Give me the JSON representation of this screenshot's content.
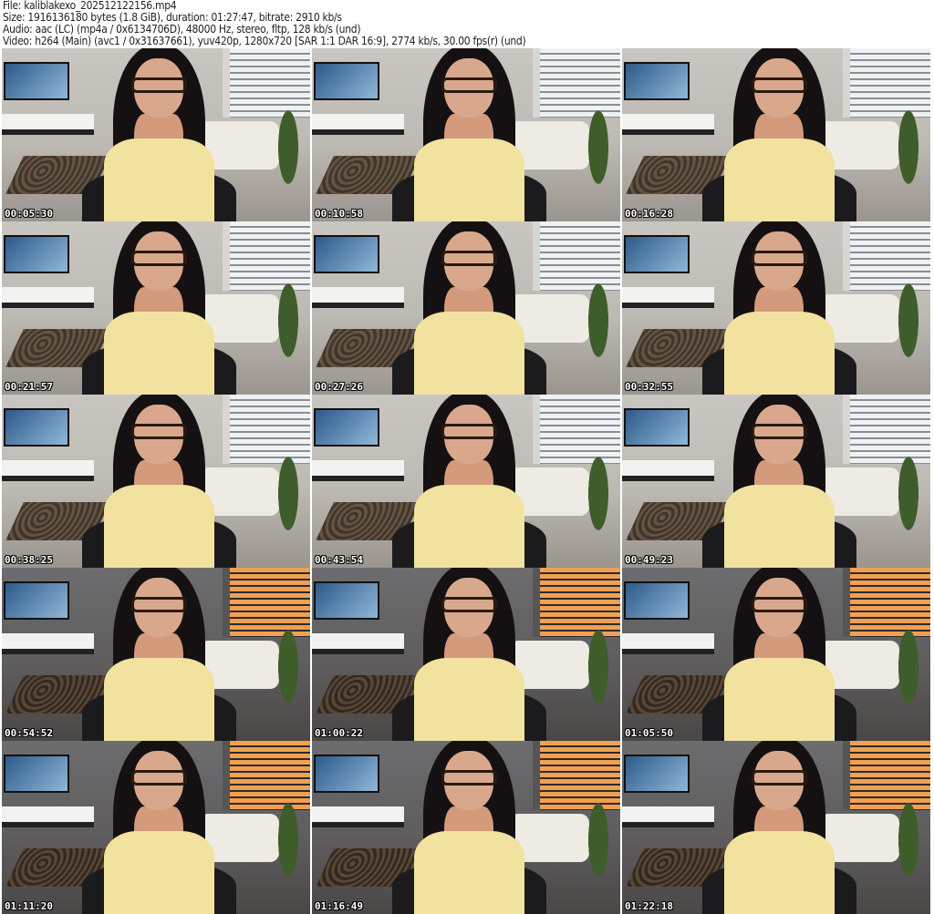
{
  "header": {
    "file": "File: kaliblakexo_202512122156.mp4",
    "size": "Size: 1916136180 bytes (1.8 GiB), duration: 01:27:47, bitrate: 2910 kb/s",
    "audio": "Audio: aac (LC) (mp4a / 0x6134706D), 48000 Hz, stereo, fltp, 128 kb/s (und)",
    "video": "Video: h264 (Main) (avc1 / 0x31637661), yuv420p, 1280x720 [SAR 1:1 DAR 16:9], 2774 kb/s, 30.00 fps(r) (und)"
  },
  "thumbnails": [
    {
      "timestamp": "00:05:30",
      "tone": "light"
    },
    {
      "timestamp": "00:10:58",
      "tone": "light"
    },
    {
      "timestamp": "00:16:28",
      "tone": "light"
    },
    {
      "timestamp": "00:21:57",
      "tone": "light"
    },
    {
      "timestamp": "00:27:26",
      "tone": "light"
    },
    {
      "timestamp": "00:32:55",
      "tone": "light"
    },
    {
      "timestamp": "00:38:25",
      "tone": "light"
    },
    {
      "timestamp": "00:43:54",
      "tone": "light"
    },
    {
      "timestamp": "00:49:23",
      "tone": "light"
    },
    {
      "timestamp": "00:54:52",
      "tone": "dark"
    },
    {
      "timestamp": "01:00:22",
      "tone": "dark"
    },
    {
      "timestamp": "01:05:50",
      "tone": "dark"
    },
    {
      "timestamp": "01:11:20",
      "tone": "dark"
    },
    {
      "timestamp": "01:16:49",
      "tone": "dark"
    },
    {
      "timestamp": "01:22:18",
      "tone": "dark"
    }
  ]
}
